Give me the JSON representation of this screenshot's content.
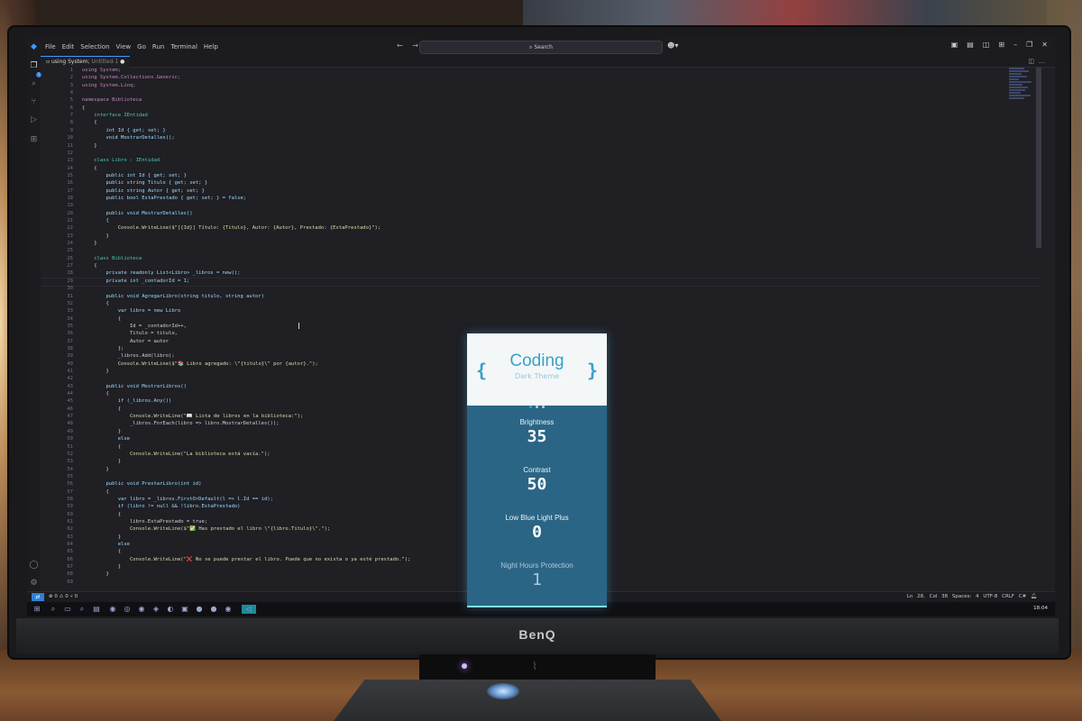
{
  "window": {
    "menu": [
      "File",
      "Edit",
      "Selection",
      "View",
      "Go",
      "Run",
      "Terminal",
      "Help"
    ],
    "search_placeholder": "Search",
    "nav_arrows": "← →"
  },
  "tab": {
    "name": "using System;",
    "path": "Untitled-1",
    "modified_marker": "●"
  },
  "editor": {
    "lines": [
      {
        "n": "1",
        "text": "using System;"
      },
      {
        "n": "2",
        "text": "using System.Collections.Generic;"
      },
      {
        "n": "3",
        "text": "using System.Linq;"
      },
      {
        "n": "4",
        "text": ""
      },
      {
        "n": "5",
        "text": "namespace Biblioteca"
      },
      {
        "n": "6",
        "text": "{"
      },
      {
        "n": "7",
        "text": "    interface IEntidad"
      },
      {
        "n": "8",
        "text": "    {"
      },
      {
        "n": "9",
        "text": "        int Id { get; set; }"
      },
      {
        "n": "10",
        "text": "        void MostrarDetalles();"
      },
      {
        "n": "11",
        "text": "    }"
      },
      {
        "n": "12",
        "text": ""
      },
      {
        "n": "13",
        "text": "    class Libro : IEntidad"
      },
      {
        "n": "14",
        "text": "    {"
      },
      {
        "n": "15",
        "text": "        public int Id { get; set; }"
      },
      {
        "n": "16",
        "text": "        public string Titulo { get; set; }"
      },
      {
        "n": "17",
        "text": "        public string Autor { get; set; }"
      },
      {
        "n": "18",
        "text": "        public bool EstaPrestado { get; set; } = false;"
      },
      {
        "n": "19",
        "text": ""
      },
      {
        "n": "20",
        "text": "        public void MostrarDetalles()"
      },
      {
        "n": "21",
        "text": "        {"
      },
      {
        "n": "22",
        "text": "            Console.WriteLine($\"[{Id}] Título: {Titulo}, Autor: {Autor}, Prestado: {EstaPrestado}\");"
      },
      {
        "n": "23",
        "text": "        }"
      },
      {
        "n": "24",
        "text": "    }"
      },
      {
        "n": "25",
        "text": ""
      },
      {
        "n": "26",
        "text": "    class Biblioteca"
      },
      {
        "n": "27",
        "text": "    {"
      },
      {
        "n": "28",
        "text": "        private readonly List<Libro> _libros = new();"
      },
      {
        "n": "29",
        "text": "        private int _contadorId = 1;"
      },
      {
        "n": "30",
        "text": ""
      },
      {
        "n": "31",
        "text": "        public void AgregarLibro(string titulo, string autor)"
      },
      {
        "n": "32",
        "text": "        {"
      },
      {
        "n": "33",
        "text": "            var libro = new Libro"
      },
      {
        "n": "34",
        "text": "            {"
      },
      {
        "n": "35",
        "text": "                Id = _contadorId++,"
      },
      {
        "n": "36",
        "text": "                Titulo = titulo,"
      },
      {
        "n": "37",
        "text": "                Autor = autor"
      },
      {
        "n": "38",
        "text": "            };"
      },
      {
        "n": "39",
        "text": "            _libros.Add(libro);"
      },
      {
        "n": "40",
        "text": "            Console.WriteLine($\"📚 Libro agregado: \\\"{titulo}\\\" por {autor}.\");"
      },
      {
        "n": "41",
        "text": "        }"
      },
      {
        "n": "42",
        "text": ""
      },
      {
        "n": "43",
        "text": "        public void MostrarLibros()"
      },
      {
        "n": "44",
        "text": "        {"
      },
      {
        "n": "45",
        "text": "            if (_libros.Any())"
      },
      {
        "n": "46",
        "text": "            {"
      },
      {
        "n": "47",
        "text": "                Console.WriteLine(\"📖 Lista de libros en la biblioteca:\");"
      },
      {
        "n": "48",
        "text": "                _libros.ForEach(libro => libro.MostrarDetalles());"
      },
      {
        "n": "49",
        "text": "            }"
      },
      {
        "n": "50",
        "text": "            else"
      },
      {
        "n": "51",
        "text": "            {"
      },
      {
        "n": "52",
        "text": "                Console.WriteLine(\"La biblioteca está vacía.\");"
      },
      {
        "n": "53",
        "text": "            }"
      },
      {
        "n": "54",
        "text": "        }"
      },
      {
        "n": "55",
        "text": ""
      },
      {
        "n": "56",
        "text": "        public void PrestarLibro(int id)"
      },
      {
        "n": "57",
        "text": "        {"
      },
      {
        "n": "58",
        "text": "            var libro = _libros.FirstOrDefault(l => l.Id == id);"
      },
      {
        "n": "59",
        "text": "            if (libro != null && !libro.EstaPrestado)"
      },
      {
        "n": "60",
        "text": "            {"
      },
      {
        "n": "61",
        "text": "                libro.EstaPrestado = true;"
      },
      {
        "n": "62",
        "text": "                Console.WriteLine($\"✅ Has prestado el libro \\\"{libro.Titulo}\\\".\");"
      },
      {
        "n": "63",
        "text": "            }"
      },
      {
        "n": "64",
        "text": "            else"
      },
      {
        "n": "65",
        "text": "            {"
      },
      {
        "n": "66",
        "text": "                Console.WriteLine(\"❌ No se puede prestar el libro. Puede que no exista o ya esté prestado.\");"
      },
      {
        "n": "67",
        "text": "            }"
      },
      {
        "n": "68",
        "text": "        }"
      },
      {
        "n": "69",
        "text": ""
      }
    ]
  },
  "status": {
    "remote": "⇄",
    "problems": "⊗ 0 ⚠ 0",
    "ports": "⑂ 0",
    "position": "Ln 28, Col 38",
    "spaces": "Spaces: 4",
    "encoding": "UTF-8",
    "eol": "CRLF",
    "language": "C#"
  },
  "taskbar": {
    "clock": "18:04"
  },
  "osd": {
    "title": "Coding",
    "subtitle": "Dark Theme",
    "brace_left": "{",
    "brace_right": "}",
    "items": [
      {
        "label": "Brightness",
        "value": "35"
      },
      {
        "label": "Contrast",
        "value": "50"
      },
      {
        "label": "Low Blue Light Plus",
        "value": "0"
      },
      {
        "label": "Night Hours Protection",
        "value": "1"
      }
    ]
  },
  "monitor": {
    "brand": "BenQ"
  },
  "colors": {
    "keyword": "#c586c0",
    "type": "#4ec9b0",
    "accent": "#3aa0c9",
    "osd_panel": "#2b6585",
    "vscode_blue": "#2f7fd6"
  }
}
